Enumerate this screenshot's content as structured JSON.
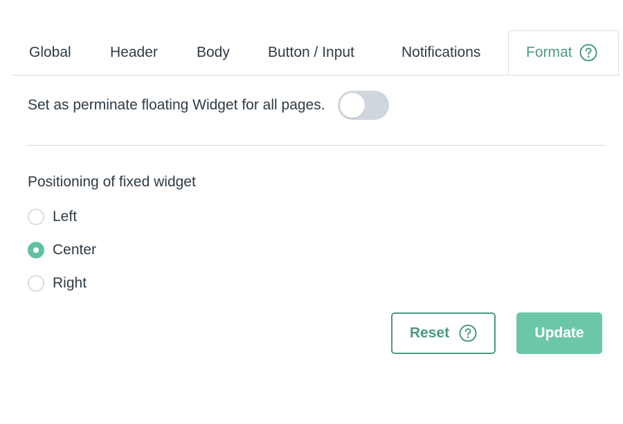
{
  "tabs": [
    {
      "label": "Global"
    },
    {
      "label": "Header"
    },
    {
      "label": "Body"
    },
    {
      "label": "Button / Input"
    },
    {
      "label": "Notifications"
    },
    {
      "label": "Format",
      "active": true,
      "icon": "question-circle-icon"
    }
  ],
  "floating": {
    "label": "Set as perminate floating Widget for all pages.",
    "enabled": false
  },
  "positioning": {
    "label": "Positioning of fixed widget",
    "options": [
      {
        "label": "Left",
        "checked": false
      },
      {
        "label": "Center",
        "checked": true
      },
      {
        "label": "Right",
        "checked": false
      }
    ]
  },
  "actions": {
    "reset_label": "Reset",
    "reset_icon": "question-circle-icon",
    "update_label": "Update"
  },
  "colors": {
    "accent": "#4a9a7e",
    "accent_light": "#6cc7aa",
    "toggle_off": "#cfd6de",
    "text": "#2d3a45"
  }
}
